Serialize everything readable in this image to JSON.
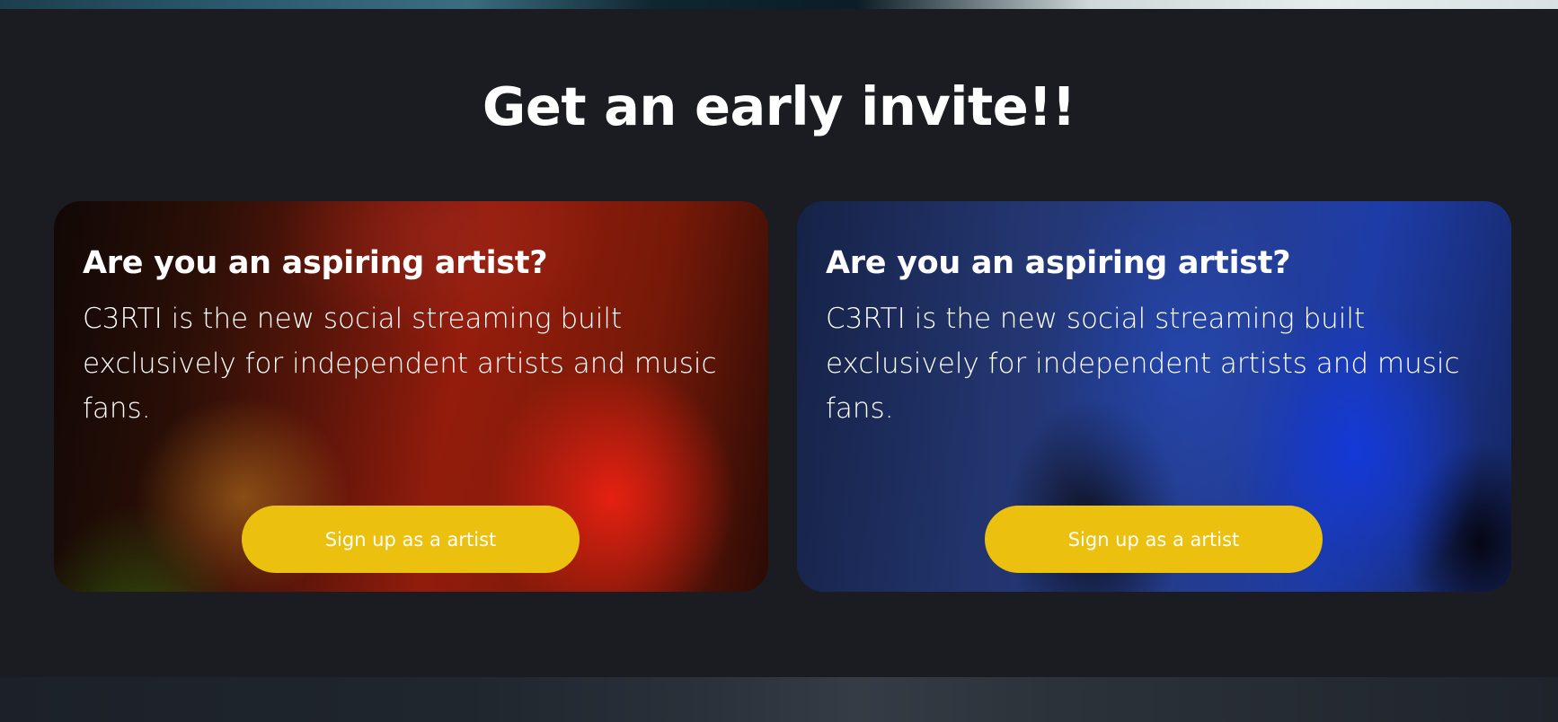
{
  "heading": "Get an early invite!!",
  "cards": [
    {
      "theme": "red",
      "title": "Are you an aspiring artist?",
      "description": "C3RTI is the new social streaming built exclusively for independent artists and music fans.",
      "button_label": "Sign up as a artist"
    },
    {
      "theme": "blue",
      "title": "Are you an aspiring artist?",
      "description": "C3RTI is the new social streaming built exclusively for independent artists and music fans.",
      "button_label": "Sign up as a artist"
    }
  ],
  "colors": {
    "background": "#1a1c22",
    "button": "#ebc00e",
    "text": "#ffffff"
  }
}
